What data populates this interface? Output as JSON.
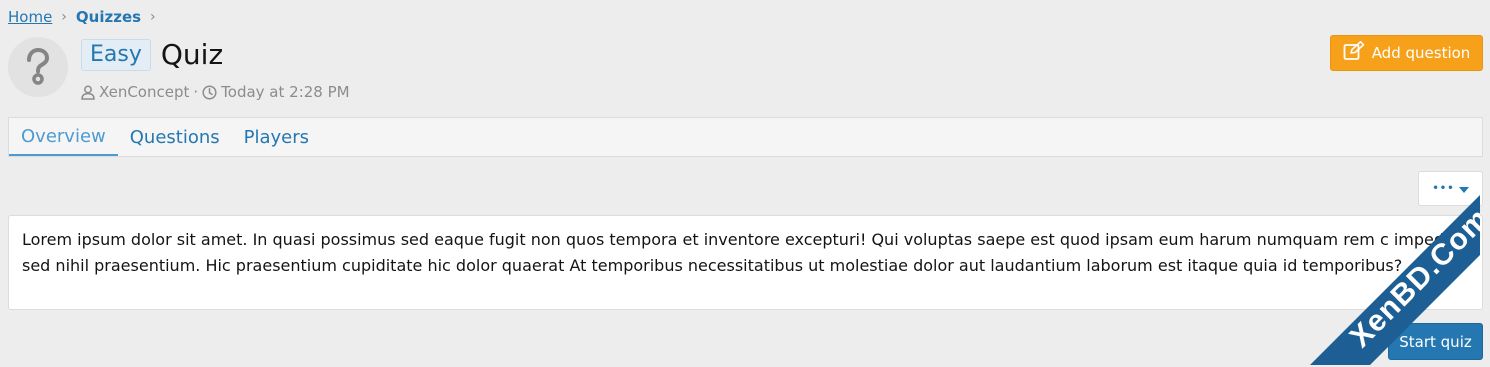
{
  "breadcrumb": {
    "home": "Home",
    "quizzes": "Quizzes"
  },
  "quiz": {
    "prefix": "Easy",
    "title": "Quiz",
    "author": "XenConcept",
    "separator": "·",
    "time": "Today at 2:28 PM"
  },
  "actions": {
    "add_question": "Add question",
    "more": "•••",
    "start_quiz": "Start quiz"
  },
  "tabs": [
    {
      "label": "Overview",
      "active": true
    },
    {
      "label": "Questions",
      "active": false
    },
    {
      "label": "Players",
      "active": false
    }
  ],
  "description": "Lorem ipsum dolor sit amet. In quasi possimus sed eaque fugit non quos tempora et inventore excepturi! Qui voluptas saepe est quod ipsam eum harum numquam rem c impedit sed nihil praesentium. Hic praesentium cupiditate hic dolor quaerat At temporibus necessitatibus ut molestiae dolor aut laudantium laborum est itaque quia id temporibus?",
  "watermark": "XenBD.Com",
  "colors": {
    "link": "#2577b1",
    "accent_orange": "#f7a11a",
    "primary_button": "#2577b1",
    "watermark_blue": "#1d5f94"
  }
}
